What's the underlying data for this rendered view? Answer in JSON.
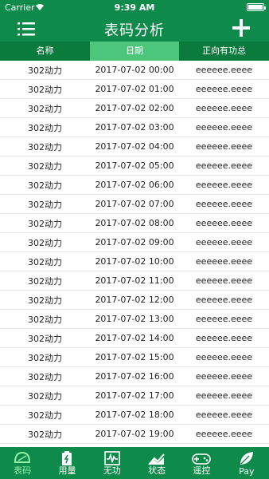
{
  "status_bar": {
    "carrier": "Carrier",
    "time": "9:39 AM"
  },
  "nav": {
    "title": "表码分析"
  },
  "columns": [
    "名称",
    "日期",
    "正向有功总"
  ],
  "rows": [
    {
      "name": "302动力",
      "date": "2017-07-02 00:00",
      "value": "eeeeee.eeee"
    },
    {
      "name": "302动力",
      "date": "2017-07-02 01:00",
      "value": "eeeeee.eeee"
    },
    {
      "name": "302动力",
      "date": "2017-07-02 02:00",
      "value": "eeeeee.eeee"
    },
    {
      "name": "302动力",
      "date": "2017-07-02 03:00",
      "value": "eeeeee.eeee"
    },
    {
      "name": "302动力",
      "date": "2017-07-02 04:00",
      "value": "eeeeee.eeee"
    },
    {
      "name": "302动力",
      "date": "2017-07-02 05:00",
      "value": "eeeeee.eeee"
    },
    {
      "name": "302动力",
      "date": "2017-07-02 06:00",
      "value": "eeeeee.eeee"
    },
    {
      "name": "302动力",
      "date": "2017-07-02 07:00",
      "value": "eeeeee.eeee"
    },
    {
      "name": "302动力",
      "date": "2017-07-02 08:00",
      "value": "eeeeee.eeee"
    },
    {
      "name": "302动力",
      "date": "2017-07-02 09:00",
      "value": "eeeeee.eeee"
    },
    {
      "name": "302动力",
      "date": "2017-07-02 10:00",
      "value": "eeeeee.eeee"
    },
    {
      "name": "302动力",
      "date": "2017-07-02 11:00",
      "value": "eeeeee.eeee"
    },
    {
      "name": "302动力",
      "date": "2017-07-02 12:00",
      "value": "eeeeee.eeee"
    },
    {
      "name": "302动力",
      "date": "2017-07-02 13:00",
      "value": "eeeeee.eeee"
    },
    {
      "name": "302动力",
      "date": "2017-07-02 14:00",
      "value": "eeeeee.eeee"
    },
    {
      "name": "302动力",
      "date": "2017-07-02 15:00",
      "value": "eeeeee.eeee"
    },
    {
      "name": "302动力",
      "date": "2017-07-02 16:00",
      "value": "eeeeee.eeee"
    },
    {
      "name": "302动力",
      "date": "2017-07-02 17:00",
      "value": "eeeeee.eeee"
    },
    {
      "name": "302动力",
      "date": "2017-07-02 18:00",
      "value": "eeeeee.eeee"
    },
    {
      "name": "302动力",
      "date": "2017-07-02 19:00",
      "value": "eeeeee.eeee"
    }
  ],
  "tabs": [
    {
      "label": "表码",
      "icon": "leaf-outline-icon"
    },
    {
      "label": "用量",
      "icon": "battery-icon"
    },
    {
      "label": "无功",
      "icon": "waveform-icon"
    },
    {
      "label": "状态",
      "icon": "trend-chart-icon"
    },
    {
      "label": "遥控",
      "icon": "gamepad-icon"
    },
    {
      "label": "Pay",
      "icon": "leaf-icon"
    }
  ],
  "active_tab": 0,
  "colors": {
    "primary": "#0e8a4a",
    "header_dark": "#0b7a3d",
    "header_active": "#4bc67b",
    "tab_active": "#8ff0a8"
  }
}
